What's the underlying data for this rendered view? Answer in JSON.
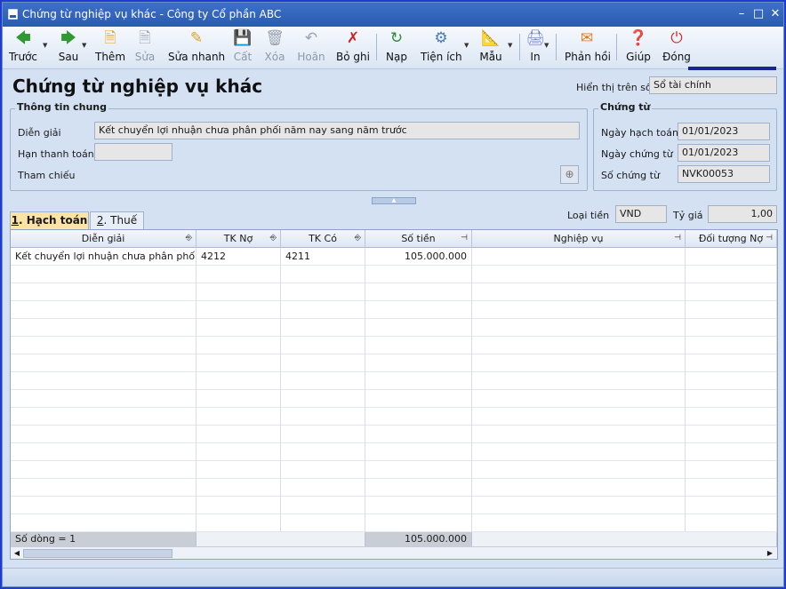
{
  "window": {
    "title": "Chứng từ nghiệp vụ khác - Công ty Cổ phần ABC"
  },
  "toolbar": {
    "buttons": [
      {
        "label": "Trước",
        "icon": "arrow-left-icon",
        "enabled": true
      },
      {
        "label": "Sau",
        "icon": "arrow-right-icon",
        "enabled": true
      },
      {
        "label": "Thêm",
        "icon": "new-document-icon",
        "enabled": true
      },
      {
        "label": "Sửa",
        "icon": "edit-document-icon",
        "enabled": false
      },
      {
        "label": "Sửa nhanh",
        "icon": "quick-edit-icon",
        "enabled": true
      },
      {
        "label": "Cất",
        "icon": "save-icon",
        "enabled": false
      },
      {
        "label": "Xóa",
        "icon": "delete-icon",
        "enabled": false
      },
      {
        "label": "Hoãn",
        "icon": "undo-icon",
        "enabled": false
      },
      {
        "label": "Bỏ ghi",
        "icon": "unpost-icon",
        "enabled": true
      },
      {
        "label": "Nạp",
        "icon": "reload-icon",
        "enabled": true
      },
      {
        "label": "Tiện ích",
        "icon": "tools-icon",
        "enabled": true
      },
      {
        "label": "Mẫu",
        "icon": "template-icon",
        "enabled": true
      },
      {
        "label": "In",
        "icon": "printer-icon",
        "enabled": true
      },
      {
        "label": "Phản hồi",
        "icon": "mail-icon",
        "enabled": true
      },
      {
        "label": "Giúp",
        "icon": "help-icon",
        "enabled": true
      },
      {
        "label": "Đóng",
        "icon": "close-icon",
        "enabled": true
      }
    ]
  },
  "form": {
    "title": "Chứng từ nghiệp vụ khác",
    "hien_thi_label": "Hiển thị trên sổ",
    "hien_thi_value": "Sổ tài chính"
  },
  "thong_tin_chung": {
    "title": "Thông tin chung",
    "dien_giai_label": "Diễn giải",
    "dien_giai_value": "Kết chuyển lợi nhuận chưa phân phối năm nay sang năm trước",
    "han_thanh_toan_label": "Hạn thanh toán",
    "han_thanh_toan_value": "",
    "tham_chieu_label": "Tham chiếu"
  },
  "chung_tu": {
    "title": "Chứng từ",
    "ngay_hach_toan_label": "Ngày hạch toán",
    "ngay_hach_toan_value": "01/01/2023",
    "ngay_chung_tu_label": "Ngày chứng từ",
    "ngay_chung_tu_value": "01/01/2023",
    "so_chung_tu_label": "Số chứng từ",
    "so_chung_tu_value": "NVK00053"
  },
  "tabs": [
    {
      "num": "1",
      "label": ". Hạch toán"
    },
    {
      "num": "2",
      "label": ". Thuế"
    }
  ],
  "currency": {
    "loai_tien_label": "Loại tiền",
    "loai_tien_value": "VND",
    "ty_gia_label": "Tỷ giá",
    "ty_gia_value": "1,00"
  },
  "grid": {
    "columns": [
      "Diễn giải",
      "TK Nợ",
      "TK Có",
      "Số tiền",
      "Nghiệp vụ",
      "Đối tượng Nợ"
    ],
    "rows": [
      [
        "Kết chuyển lợi nhuận chưa phân phối n",
        "4212",
        "4211",
        "105.000.000",
        "",
        ""
      ]
    ],
    "footer_count": "Số dòng = 1",
    "footer_total": "105.000.000"
  }
}
